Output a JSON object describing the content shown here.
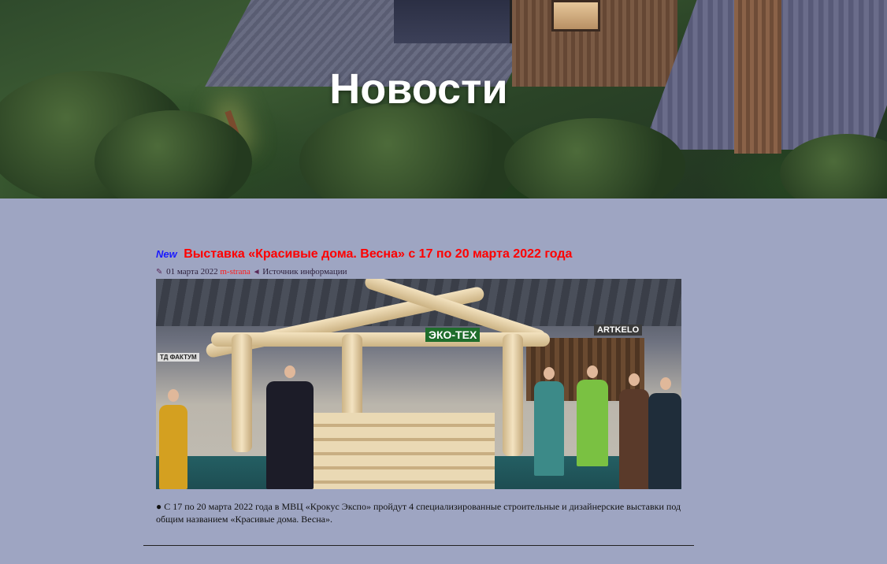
{
  "page": {
    "title": "Новости"
  },
  "post": {
    "badge": "New",
    "title": "Выставка «Красивые дома. Весна» с 17 по 20 марта 2022 года",
    "date": "01 марта 2022",
    "author": "m-strana",
    "source_label": "Источник информации",
    "photo_signs": {
      "eco": "ЭКО-ТЕХ",
      "artkelo": "ARTKELO",
      "faktum": "ТД ФАКТУМ"
    },
    "bullet": "●",
    "body": "С 17 по 20 марта 2022 года в МВЦ «Крокус Экспо» пройдут 4 специализированные строительные и дизайнерские выставки под общим названием «Красивые дома. Весна»."
  },
  "colors": {
    "background": "#9ea5c2",
    "title_red": "#ff0000",
    "badge_blue": "#1a1aff",
    "hero_text": "#ffffff"
  },
  "icons": {
    "meta_pencil": "pencil-icon",
    "meta_arrow": "arrow-left-icon"
  }
}
